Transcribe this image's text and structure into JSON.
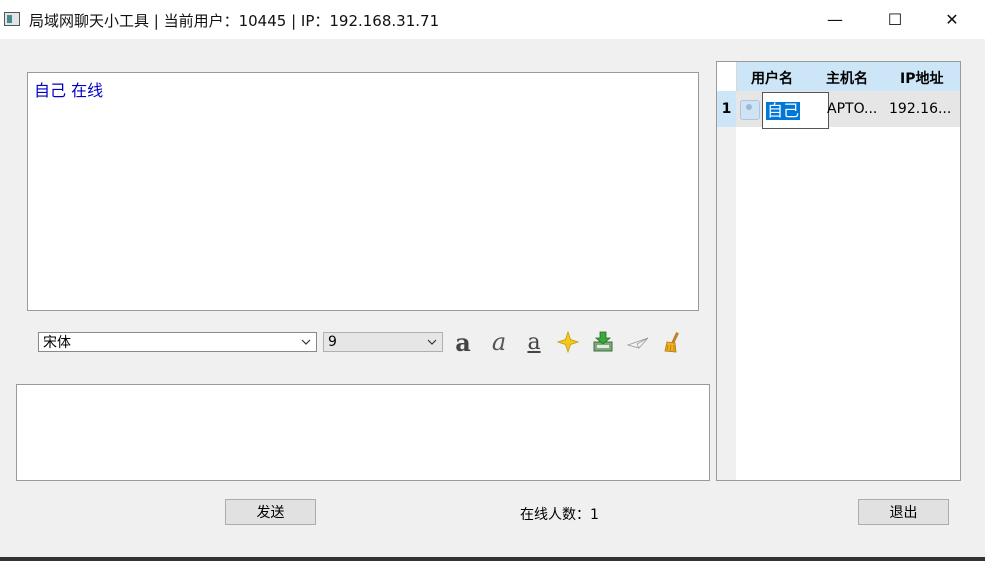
{
  "window": {
    "title": "局域网聊天小工具 | 当前用户：10445 | IP：192.168.31.71",
    "minimize_symbol": "—",
    "maximize_symbol": "☐",
    "close_symbol": "✕"
  },
  "chat": {
    "messages": [
      "自己 在线"
    ],
    "message_color": "#0000c8"
  },
  "toolbar": {
    "font_family": "宋体",
    "font_size": "9",
    "bold_label": "a",
    "italic_label": "a",
    "underline_label": "a",
    "tools": [
      "bold-icon",
      "italic-icon",
      "underline-icon",
      "color-star-icon",
      "save-icon",
      "send-file-icon",
      "clear-broom-icon"
    ]
  },
  "input": {
    "value": ""
  },
  "footer": {
    "send_label": "发送",
    "online_count_text": "在线人数：1",
    "quit_label": "退出"
  },
  "users_table": {
    "columns": [
      "用户名",
      "主机名",
      "IP地址"
    ],
    "rows": [
      {
        "index": "1",
        "username": "自己",
        "hostname": "APTO...",
        "ip": "192.16..."
      }
    ],
    "header_color": "#cde6f7"
  }
}
